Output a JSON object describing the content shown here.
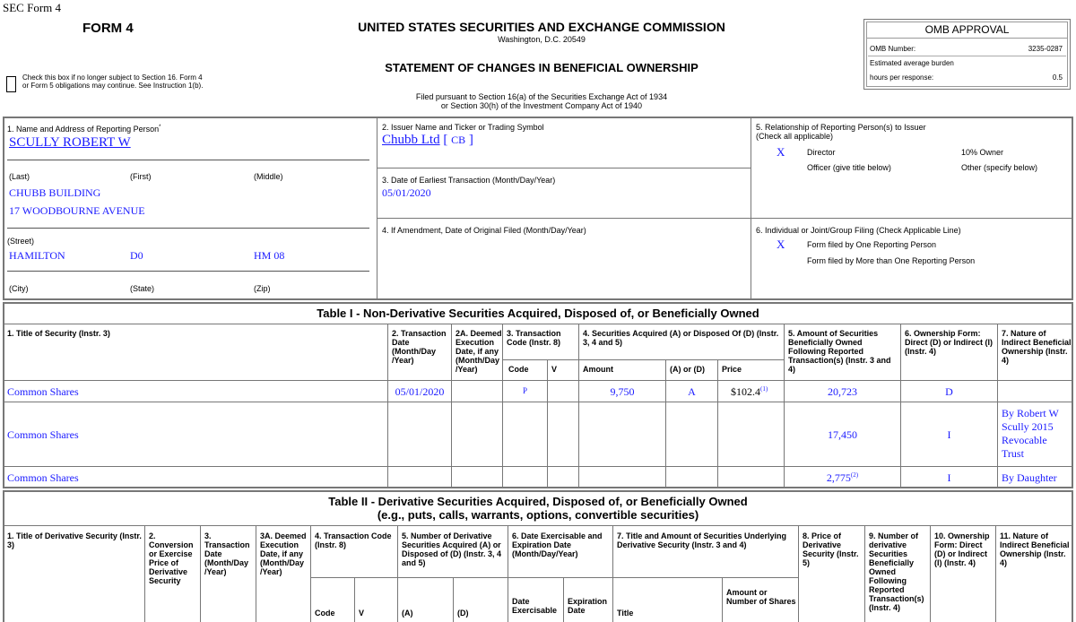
{
  "header": {
    "sec_form": "SEC Form 4",
    "form_title": "FORM 4",
    "agency": "UNITED STATES SECURITIES AND EXCHANGE COMMISSION",
    "agency_location": "Washington, D.C. 20549",
    "statement_title": "STATEMENT OF CHANGES IN BENEFICIAL OWNERSHIP",
    "filed_pursuant_1": "Filed pursuant to Section 16(a) of the Securities Exchange Act of 1934",
    "filed_pursuant_2": "or Section 30(h) of the Investment Company Act of 1940",
    "checkbox_text": "Check this box if no longer subject to Section 16. Form 4 or Form 5 obligations may continue. See Instruction 1(b)."
  },
  "omb": {
    "title": "OMB APPROVAL",
    "number_label": "OMB Number:",
    "number_value": "3235-0287",
    "burden_label_1": "Estimated average burden",
    "burden_label_2": "hours per response:",
    "burden_value": "0.5"
  },
  "box1": {
    "label": "1. Name and Address of Reporting Person",
    "label_mark": "*",
    "name": "SCULLY ROBERT W",
    "last_label": "(Last)",
    "first_label": "(First)",
    "middle_label": "(Middle)",
    "address_1": "CHUBB BUILDING",
    "address_2": "17 WOODBOURNE AVENUE",
    "street_label": "(Street)",
    "city": "HAMILTON",
    "state": "D0",
    "zip": "HM 08",
    "city_label": "(City)",
    "state_label": "(State)",
    "zip_label": "(Zip)"
  },
  "box2": {
    "label": "2. Issuer Name and Ticker or Trading Symbol",
    "issuer": "Chubb Ltd",
    "bracket_open": "[",
    "ticker": "CB",
    "bracket_close": "]"
  },
  "box3": {
    "label": "3. Date of Earliest Transaction (Month/Day/Year)",
    "value": "05/01/2020"
  },
  "box4": {
    "label": "4. If Amendment, Date of Original Filed (Month/Day/Year)"
  },
  "box5": {
    "label_1": "5. Relationship of Reporting Person(s) to Issuer",
    "label_2": "(Check all applicable)",
    "director_mark": "X",
    "director": "Director",
    "ten_pct": "10% Owner",
    "officer": "Officer (give title below)",
    "other": "Other (specify below)"
  },
  "box6": {
    "label": "6. Individual or Joint/Group Filing (Check Applicable Line)",
    "one_mark": "X",
    "one": "Form filed by One Reporting Person",
    "more": "Form filed by More than One Reporting Person"
  },
  "table1": {
    "title": "Table I - Non-Derivative Securities Acquired, Disposed of, or Beneficially Owned",
    "headers": {
      "c1": "1. Title of Security (Instr. 3)",
      "c2": "2. Transaction Date (Month/Day /Year)",
      "c2a": "2A. Deemed Execution Date, if any (Month/Day /Year)",
      "c3": "3. Transaction Code (Instr. 8)",
      "c4": "4. Securities Acquired (A) or Disposed Of (D) (Instr. 3, 4 and 5)",
      "c5": "5. Amount of Securities Beneficially Owned Following Reported Transaction(s) (Instr. 3 and 4)",
      "c6": "6. Ownership Form: Direct (D) or Indirect (I) (Instr. 4)",
      "c7": "7. Nature of Indirect Beneficial Ownership (Instr. 4)",
      "code": "Code",
      "v": "V",
      "amount": "Amount",
      "aord": "(A) or (D)",
      "price": "Price"
    },
    "rows": [
      {
        "title": "Common Shares",
        "date": "05/01/2020",
        "code": "P",
        "amount": "9,750",
        "aord": "A",
        "price": "$102.4",
        "price_fn": "(1)",
        "owned": "20,723",
        "owned_fn": "",
        "form": "D",
        "nature": ""
      },
      {
        "title": "Common Shares",
        "date": "",
        "code": "",
        "amount": "",
        "aord": "",
        "price": "",
        "price_fn": "",
        "owned": "17,450",
        "owned_fn": "",
        "form": "I",
        "nature": "By Robert W Scully 2015 Revocable Trust"
      },
      {
        "title": "Common Shares",
        "date": "",
        "code": "",
        "amount": "",
        "aord": "",
        "price": "",
        "price_fn": "",
        "owned": "2,775",
        "owned_fn": "(2)",
        "form": "I",
        "nature": "By Daughter"
      }
    ]
  },
  "table2": {
    "title_1": "Table II - Derivative Securities Acquired, Disposed of, or Beneficially Owned",
    "title_2": "(e.g., puts, calls, warrants, options, convertible securities)",
    "headers": {
      "c1": "1. Title of Derivative Security (Instr. 3)",
      "c2": "2. Conversion or Exercise Price of Derivative Security",
      "c3": "3. Transaction Date (Month/Day /Year)",
      "c3a": "3A. Deemed Execution Date, if any (Month/Day /Year)",
      "c4": "4. Transaction Code (Instr. 8)",
      "c5": "5. Number of Derivative Securities Acquired (A) or Disposed of (D) (Instr. 3, 4 and 5)",
      "c6": "6. Date Exercisable and Expiration Date (Month/Day/Year)",
      "c7": "7. Title and Amount of Securities Underlying Derivative Security (Instr. 3 and 4)",
      "c8": "8. Price of Derivative Security (Instr. 5)",
      "c9": "9. Number of derivative Securities Beneficially Owned Following Reported Transaction(s) (Instr. 4)",
      "c10": "10. Ownership Form: Direct (D) or Indirect (I) (Instr. 4)",
      "c11": "11. Nature of Indirect Beneficial Ownership (Instr. 4)",
      "code": "Code",
      "v": "V",
      "a": "(A)",
      "d": "(D)",
      "date_ex": "Date Exercisable",
      "exp": "Expiration Date",
      "title": "Title",
      "amount": "Amount or Number of Shares"
    }
  }
}
